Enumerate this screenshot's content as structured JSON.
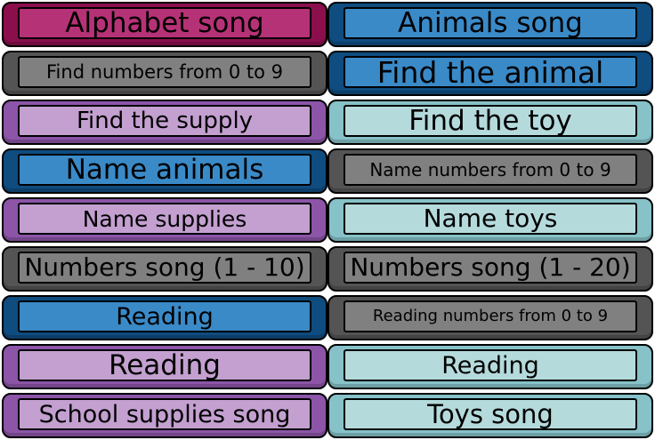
{
  "colors": {
    "magenta": {
      "outer": "#8a0f4c",
      "inner": "#b63276"
    },
    "blue": {
      "outer": "#0f4c80",
      "inner": "#3a8ac8"
    },
    "grey": {
      "outer": "#545454",
      "inner": "#808080"
    },
    "purple": {
      "outer": "#8c55a8",
      "inner": "#c3a0d0"
    },
    "teal": {
      "outer": "#86c2c8",
      "inner": "#b5dadc"
    }
  },
  "menu": {
    "left": [
      {
        "label": "Alphabet song",
        "color": "magenta"
      },
      {
        "label": "Find numbers from 0 to 9",
        "color": "grey"
      },
      {
        "label": "Find the supply",
        "color": "purple"
      },
      {
        "label": "Name animals",
        "color": "blue"
      },
      {
        "label": "Name supplies",
        "color": "purple"
      },
      {
        "label": "Numbers song (1 - 10)",
        "color": "grey"
      },
      {
        "label": "Reading",
        "color": "blue"
      },
      {
        "label": "Reading",
        "color": "purple"
      },
      {
        "label": "School supplies song",
        "color": "purple"
      }
    ],
    "right": [
      {
        "label": "Animals song",
        "color": "blue"
      },
      {
        "label": "Find the animal",
        "color": "blue"
      },
      {
        "label": "Find the toy",
        "color": "teal"
      },
      {
        "label": "Name numbers from 0 to 9",
        "color": "grey"
      },
      {
        "label": "Name toys",
        "color": "teal"
      },
      {
        "label": "Numbers song (1 - 20)",
        "color": "grey"
      },
      {
        "label": "Reading numbers from 0 to  9",
        "color": "grey"
      },
      {
        "label": "Reading",
        "color": "teal"
      },
      {
        "label": "Toys song",
        "color": "teal"
      }
    ]
  }
}
